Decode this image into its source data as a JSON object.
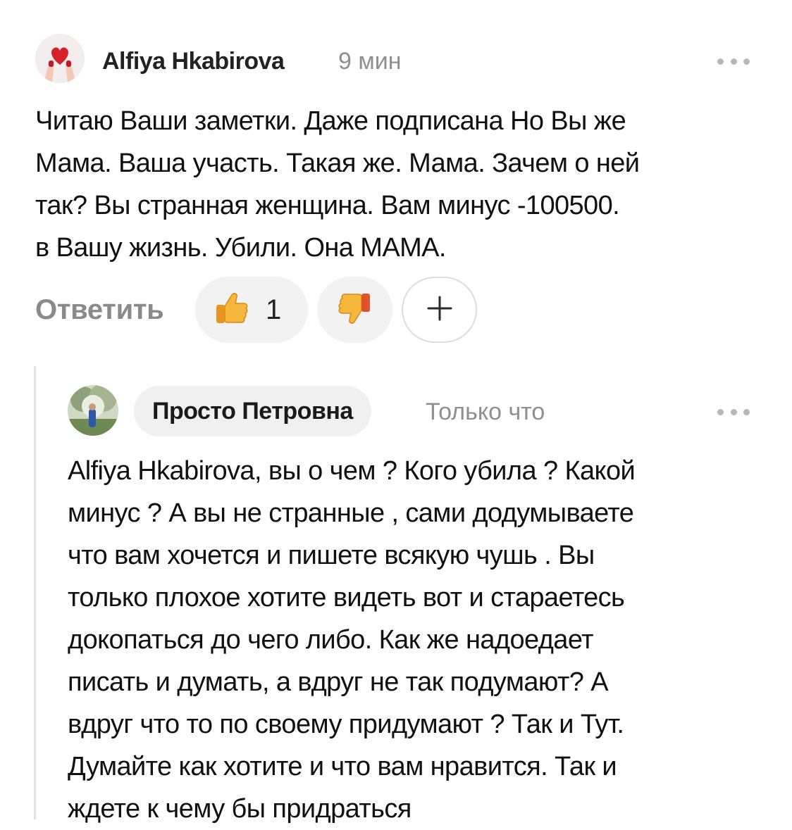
{
  "comment": {
    "author": "Alfiya Hkabirova",
    "time": "9 мин",
    "text": "Читаю Ваши заметки. Даже подписана Но Вы же\nМама. Ваша участь. Такая же. Мама. Зачем о ней\nтак? Вы странная женщина. Вам минус -100500.\nв Вашу жизнь. Убили. Она МАМА.",
    "actions": {
      "reply_label": "Ответить",
      "like_count": "1",
      "like_icon": "thumbs-up-icon",
      "dislike_icon": "thumbs-down-icon",
      "add_icon": "plus-icon"
    }
  },
  "reply": {
    "author": "Просто Петровна",
    "time": "Только что",
    "text": "Alfiya Hkabirova, вы о чем ? Кого убила ? Какой\nминус ? А вы не странные , сами додумываете\nчто вам хочется и пишете всякую чушь . Вы\nтолько плохое хотите видеть вот и стараетесь\nдокопаться до чего либо. Как же надоедает\nписать и думать, а вдруг не так подумают? А\nвдруг что то по своему придумают ? Так и Тут.\nДумайте как хотите и что вам нравится. Так и\nждете к чему бы придраться"
  },
  "colors": {
    "accent_muted": "#8a8a8a",
    "pill_bg": "#f2f2f2",
    "emoji_yellow": "#f6b73c"
  }
}
